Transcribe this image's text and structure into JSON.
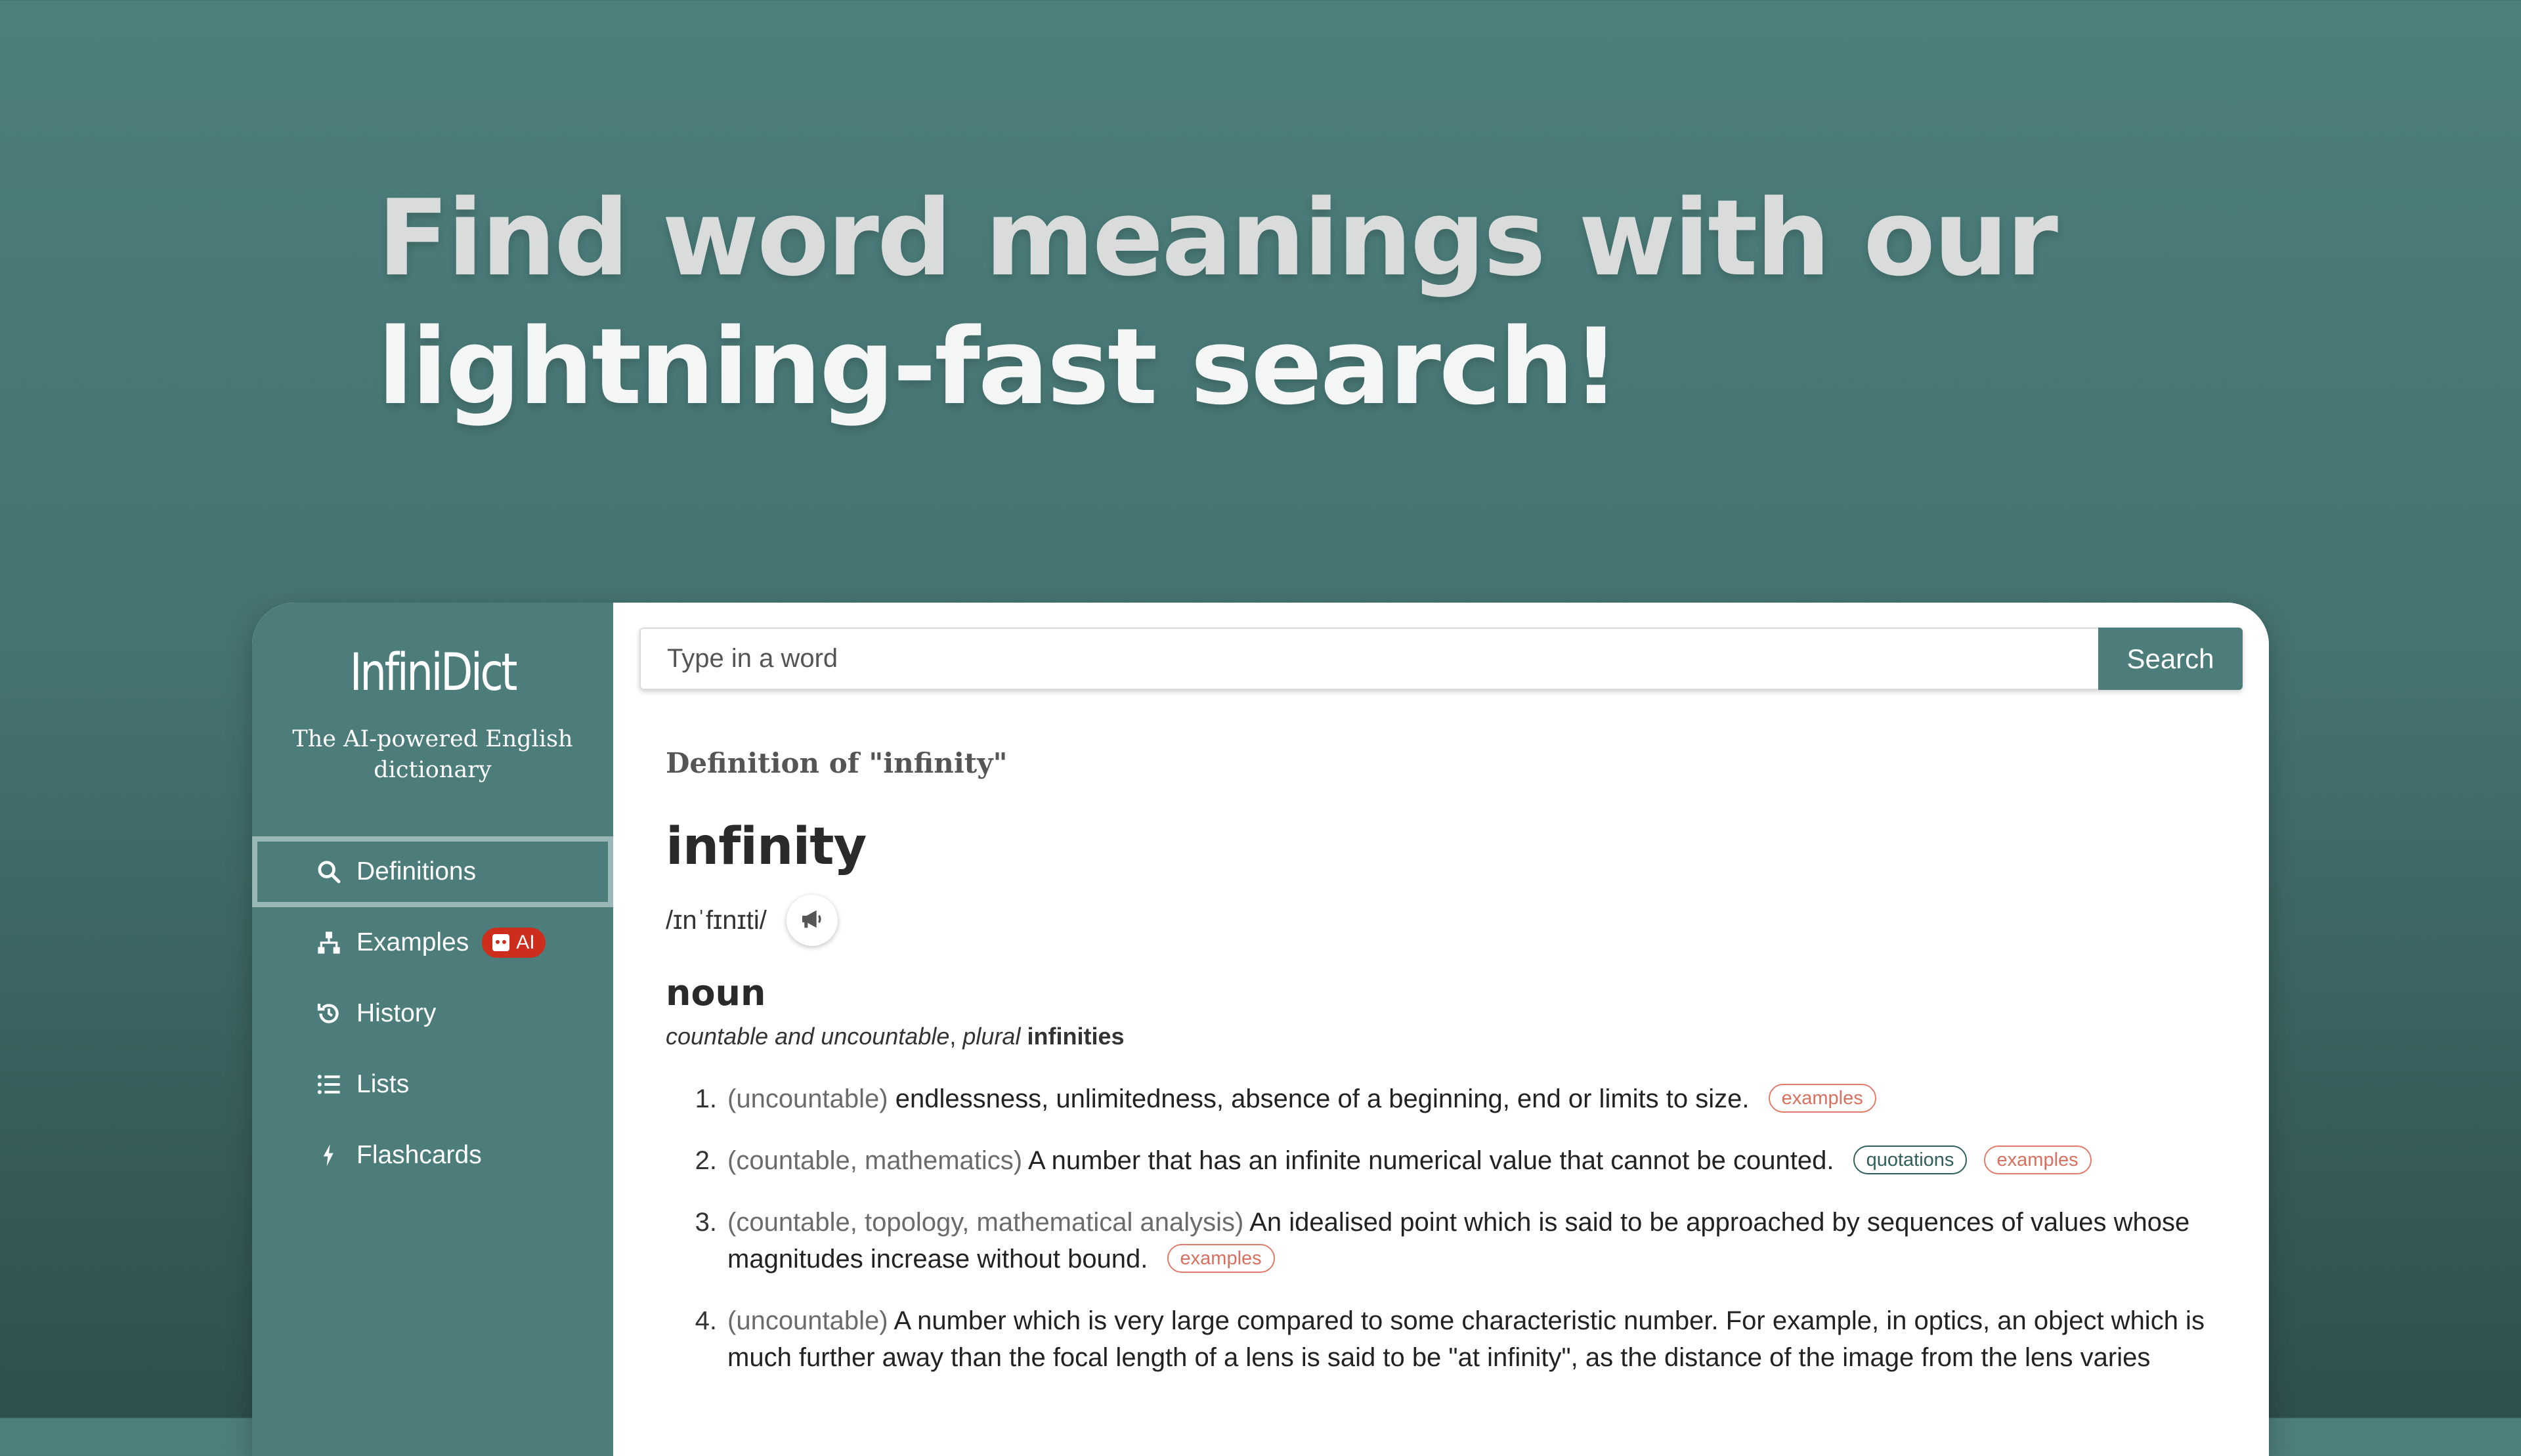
{
  "hero": {
    "line1": "Find word meanings with our",
    "line2": "lightning-fast search!"
  },
  "sidebar": {
    "brand": "InfiniDict",
    "tagline": "The AI-powered English dictionary",
    "items": [
      {
        "label": "Definitions",
        "icon": "search-icon",
        "active": true
      },
      {
        "label": "Examples",
        "icon": "sitemap-icon",
        "badge": "AI"
      },
      {
        "label": "History",
        "icon": "history-icon"
      },
      {
        "label": "Lists",
        "icon": "list-icon"
      },
      {
        "label": "Flashcards",
        "icon": "bolt-icon"
      }
    ]
  },
  "search": {
    "placeholder": "Type in a word",
    "button_label": "Search"
  },
  "definition": {
    "heading": "Definition of \"infinity\"",
    "word": "infinity",
    "pronunciation": "/ɪnˈfɪnɪti/",
    "part_of_speech": "noun",
    "grammar": {
      "countability": "countable and uncountable",
      "separator": ",",
      "plural_label": "plural",
      "plural_word": "infinities"
    },
    "senses": [
      {
        "number": "1.",
        "label": "(uncountable)",
        "text": "endlessness, unlimitedness, absence of a beginning, end or limits to size.",
        "tags": [
          "examples"
        ]
      },
      {
        "number": "2.",
        "label": "(countable, mathematics)",
        "text": "A number that has an infinite numerical value that cannot be counted.",
        "tags": [
          "quotations",
          "examples"
        ]
      },
      {
        "number": "3.",
        "label": "(countable, topology, mathematical analysis)",
        "text": "An idealised point which is said to be approached by sequences of values whose magnitudes increase without bound.",
        "tags": [
          "examples"
        ]
      },
      {
        "number": "4.",
        "label": "(uncountable)",
        "text": "A number which is very large compared to some characteristic number. For example, in optics, an object which is much further away than the focal length of a lens is said to be \"at infinity\", as the distance of the image from the lens varies",
        "tags": []
      }
    ]
  },
  "colors": {
    "accent": "#4c7d7b",
    "badge_red": "#cc2d1c",
    "examples_tag": "#d9705f",
    "quotations_tag": "#2f5f5c"
  }
}
